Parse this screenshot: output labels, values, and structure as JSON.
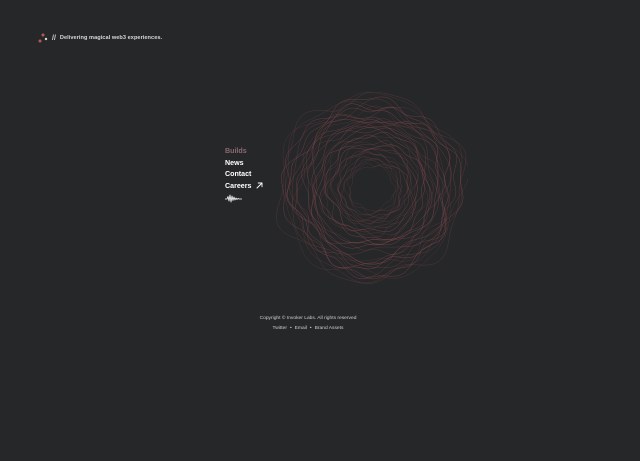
{
  "header": {
    "logo_icon": "triangle-dots-logo-icon",
    "separator": "//",
    "tagline": "Delivering magical web3 experiences."
  },
  "visual": {
    "icon": "wavy-ring-graphic-icon",
    "color": "#8a4a52"
  },
  "nav": {
    "items": [
      {
        "label": "Builds",
        "state": "active"
      },
      {
        "label": "News"
      },
      {
        "label": "Contact"
      },
      {
        "label": "Careers",
        "icon": "external-arrow-icon"
      }
    ],
    "sound_icon": "sound-wave-icon"
  },
  "footer": {
    "copyright": "Copyright © Invoker Labs. All rights reserved",
    "separator": "•",
    "links": [
      "Twitter",
      "Email",
      "Brand Assets"
    ]
  },
  "colors": {
    "background": "#262728",
    "accent": "#8a6a72",
    "text": "#ffffff"
  }
}
